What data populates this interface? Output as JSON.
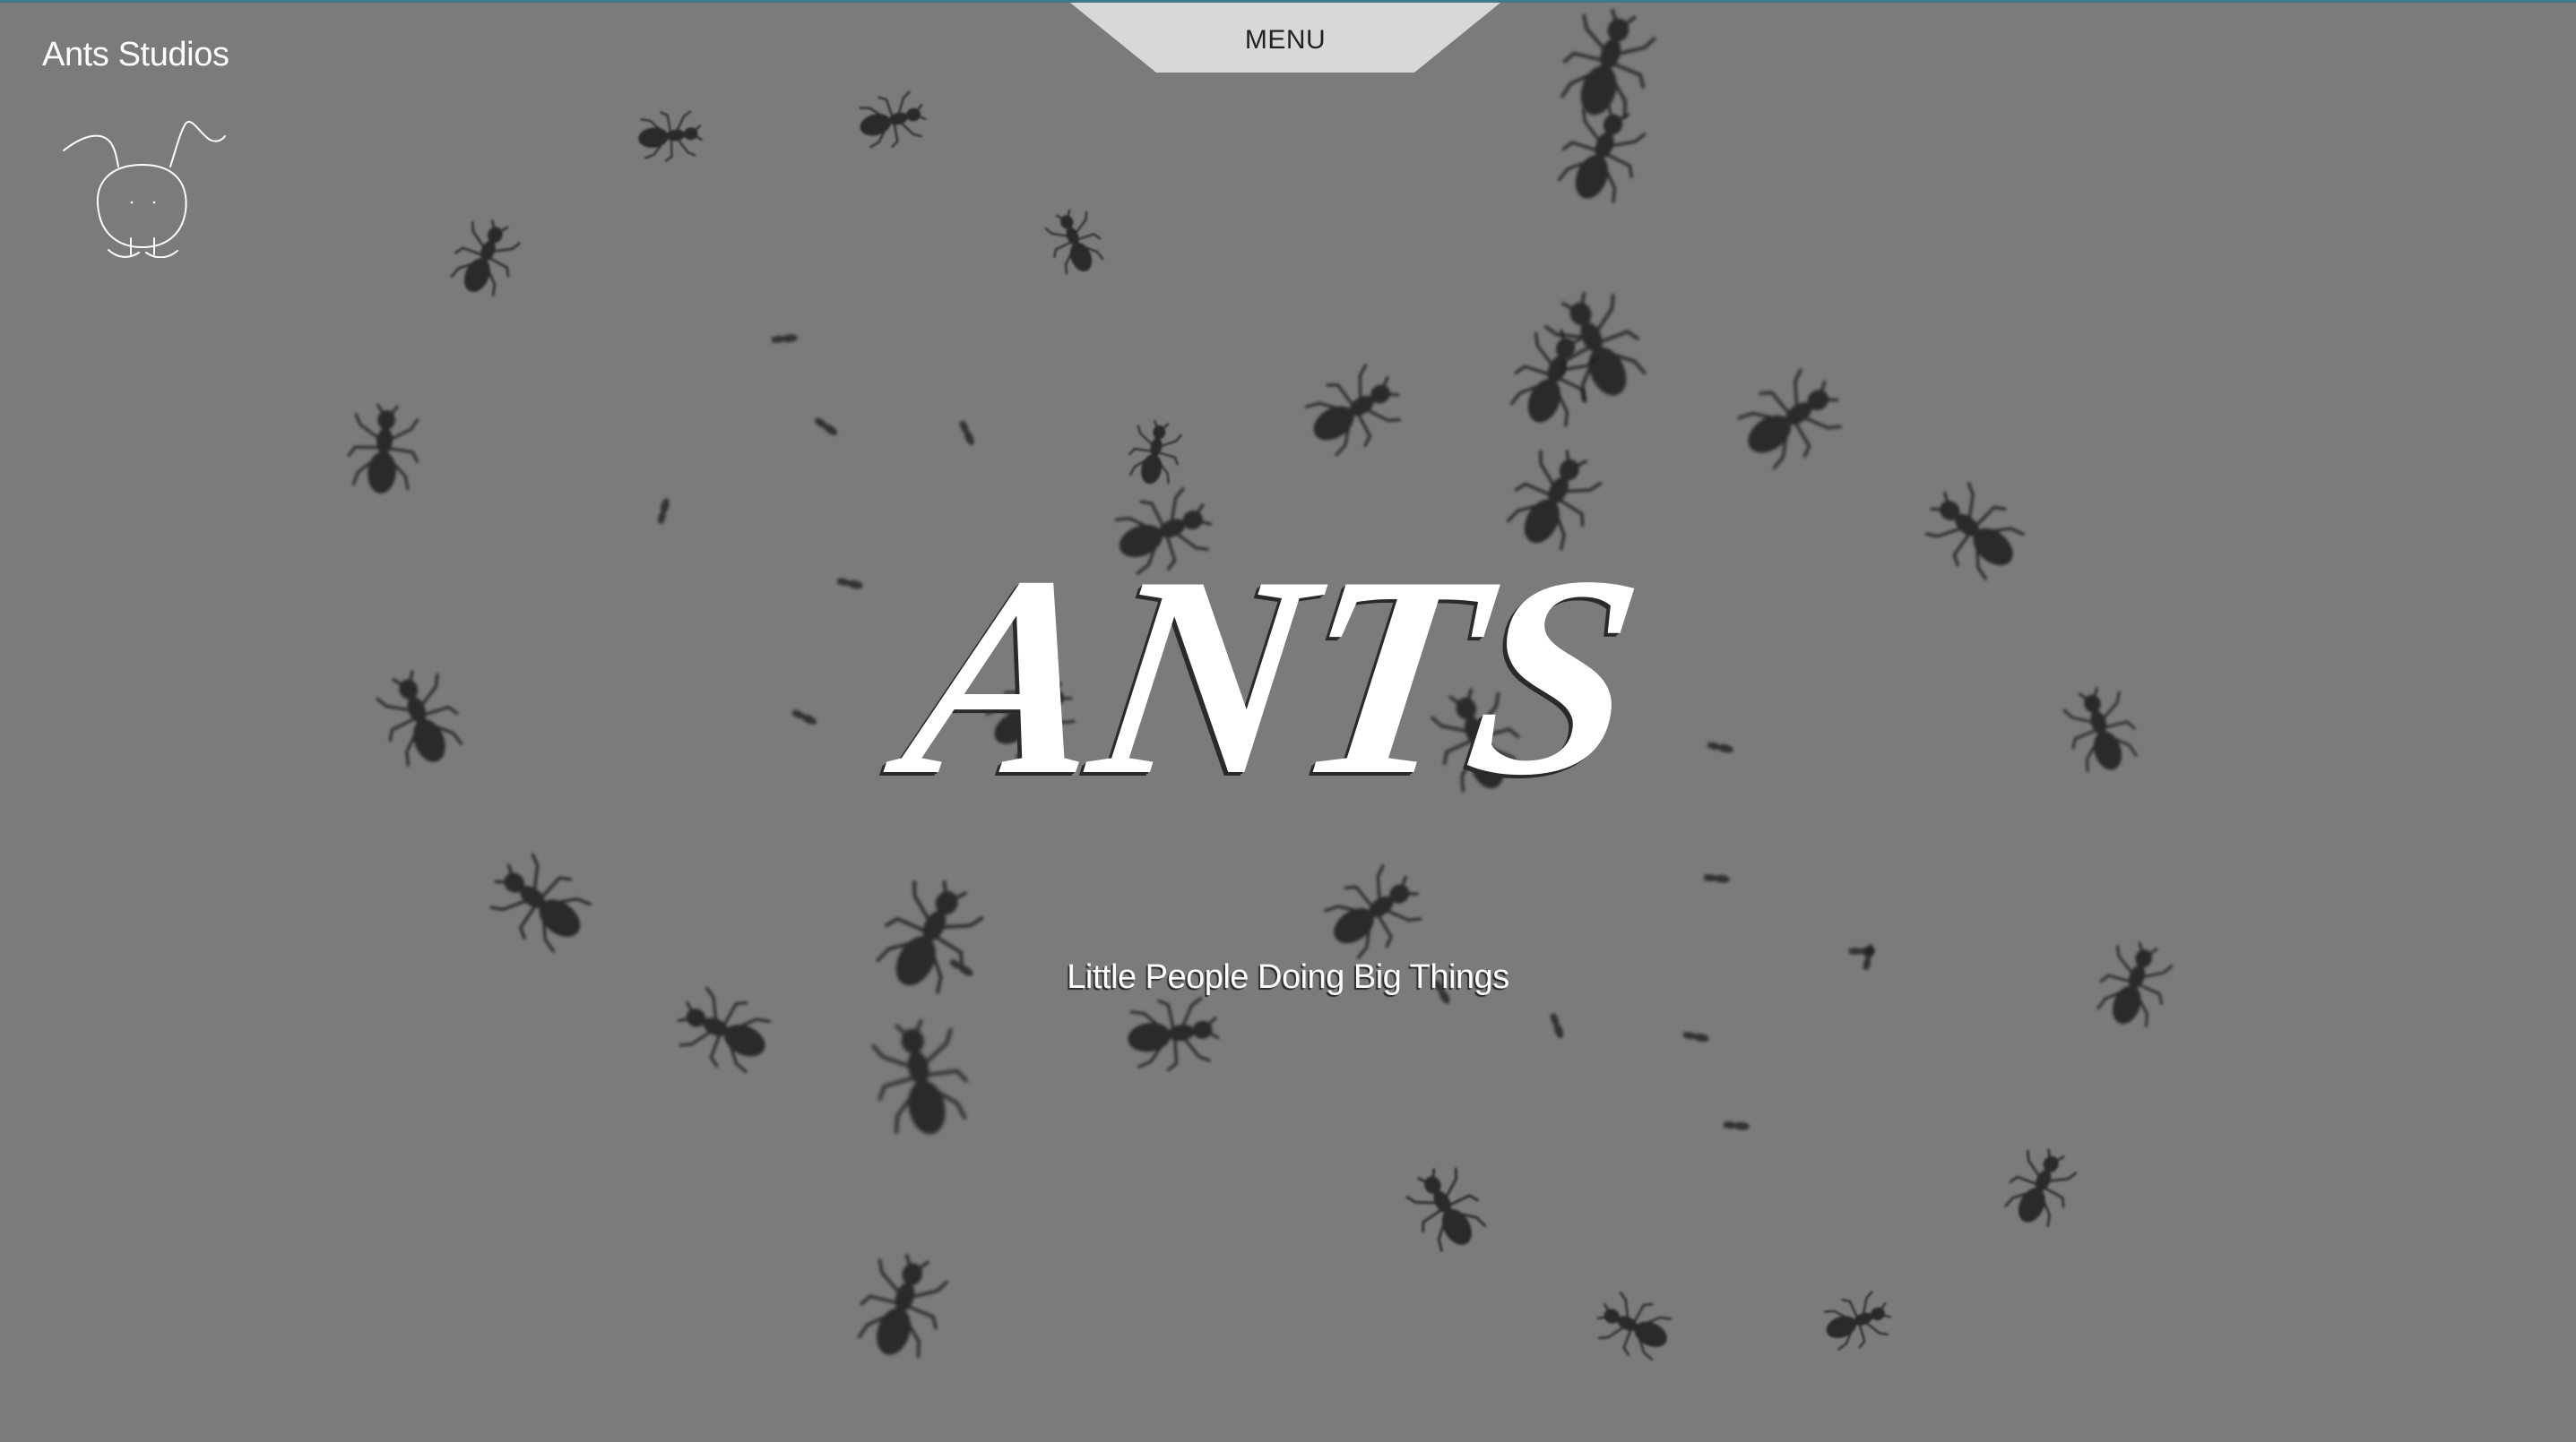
{
  "colors": {
    "background": "#7b7b7b",
    "menu_tab": "#d8d8d8",
    "accent_line": "#3f7b86",
    "text": "#ffffff"
  },
  "header": {
    "brand": "Ants Studios",
    "logo_icon": "ant-head-icon",
    "menu_label": "MENU"
  },
  "hero": {
    "title": "ANTS",
    "subtitle": "Little People Doing Big Things",
    "background_icon": "ant-swarm"
  }
}
